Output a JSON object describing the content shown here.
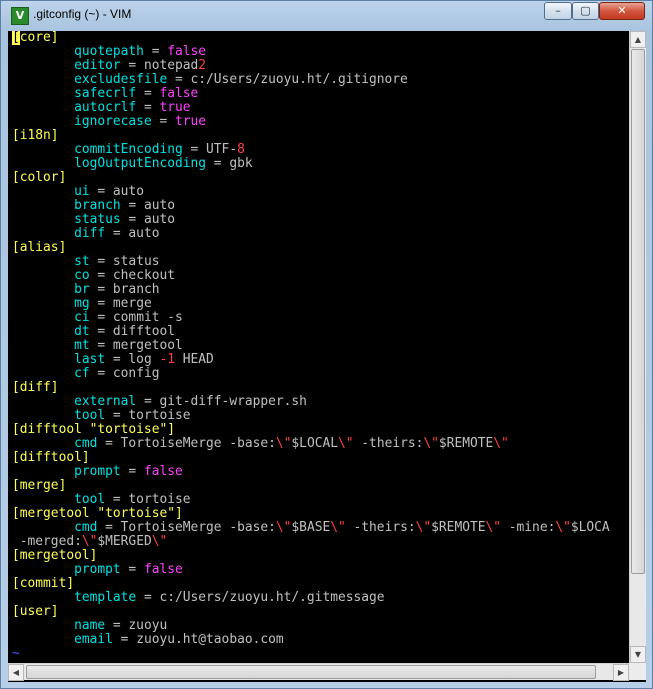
{
  "window": {
    "title": ".gitconfig (~) - VIM",
    "app_icon_label": "V",
    "controls": {
      "minimize": "–",
      "maximize": "▢",
      "close": "✕"
    }
  },
  "editor": {
    "colors": {
      "background": "#000000",
      "section_header": "#ffff55",
      "key": "#00e0e0",
      "boolean": "#ff40ff",
      "number_and_escape": "#ff4040",
      "plain": "#c0c0c0",
      "tilde": "#4060ff"
    },
    "lines": [
      [
        {
          "t": "[",
          "c": "cursor"
        },
        {
          "t": "core]",
          "c": "hdr"
        }
      ],
      [
        {
          "t": "        "
        },
        {
          "t": "quotepath",
          "c": "key"
        },
        {
          "t": " = "
        },
        {
          "t": "false",
          "c": "val"
        }
      ],
      [
        {
          "t": "        "
        },
        {
          "t": "editor",
          "c": "key"
        },
        {
          "t": " = notepad"
        },
        {
          "t": "2",
          "c": "num"
        }
      ],
      [
        {
          "t": "        "
        },
        {
          "t": "excludesfile",
          "c": "key"
        },
        {
          "t": " = c:/Users/zuoyu.ht/.gitignore"
        }
      ],
      [
        {
          "t": "        "
        },
        {
          "t": "safecrlf",
          "c": "key"
        },
        {
          "t": " = "
        },
        {
          "t": "false",
          "c": "val"
        }
      ],
      [
        {
          "t": "        "
        },
        {
          "t": "autocrlf",
          "c": "key"
        },
        {
          "t": " = "
        },
        {
          "t": "true",
          "c": "val"
        }
      ],
      [
        {
          "t": "        "
        },
        {
          "t": "ignorecase",
          "c": "key"
        },
        {
          "t": " = "
        },
        {
          "t": "true",
          "c": "val"
        }
      ],
      [
        {
          "t": "[i18n]",
          "c": "hdr"
        }
      ],
      [
        {
          "t": "        "
        },
        {
          "t": "commitEncoding",
          "c": "key"
        },
        {
          "t": " = UTF-"
        },
        {
          "t": "8",
          "c": "num"
        }
      ],
      [
        {
          "t": "        "
        },
        {
          "t": "logOutputEncoding",
          "c": "key"
        },
        {
          "t": " = gbk"
        }
      ],
      [
        {
          "t": "[color]",
          "c": "hdr"
        }
      ],
      [
        {
          "t": "        "
        },
        {
          "t": "ui",
          "c": "key"
        },
        {
          "t": " = auto"
        }
      ],
      [
        {
          "t": "        "
        },
        {
          "t": "branch",
          "c": "key"
        },
        {
          "t": " = auto"
        }
      ],
      [
        {
          "t": "        "
        },
        {
          "t": "status",
          "c": "key"
        },
        {
          "t": " = auto"
        }
      ],
      [
        {
          "t": "        "
        },
        {
          "t": "diff",
          "c": "key"
        },
        {
          "t": " = auto"
        }
      ],
      [
        {
          "t": "[alias]",
          "c": "hdr"
        }
      ],
      [
        {
          "t": "        "
        },
        {
          "t": "st",
          "c": "key"
        },
        {
          "t": " = status"
        }
      ],
      [
        {
          "t": "        "
        },
        {
          "t": "co",
          "c": "key"
        },
        {
          "t": " = checkout"
        }
      ],
      [
        {
          "t": "        "
        },
        {
          "t": "br",
          "c": "key"
        },
        {
          "t": " = branch"
        }
      ],
      [
        {
          "t": "        "
        },
        {
          "t": "mg",
          "c": "key"
        },
        {
          "t": " = merge"
        }
      ],
      [
        {
          "t": "        "
        },
        {
          "t": "ci",
          "c": "key"
        },
        {
          "t": " = commit -s"
        }
      ],
      [
        {
          "t": "        "
        },
        {
          "t": "dt",
          "c": "key"
        },
        {
          "t": " = difftool"
        }
      ],
      [
        {
          "t": "        "
        },
        {
          "t": "mt",
          "c": "key"
        },
        {
          "t": " = mergetool"
        }
      ],
      [
        {
          "t": "        "
        },
        {
          "t": "last",
          "c": "key"
        },
        {
          "t": " = log "
        },
        {
          "t": "-1",
          "c": "num"
        },
        {
          "t": " HEAD"
        }
      ],
      [
        {
          "t": "        "
        },
        {
          "t": "cf",
          "c": "key"
        },
        {
          "t": " = config"
        }
      ],
      [
        {
          "t": "[diff]",
          "c": "hdr"
        }
      ],
      [
        {
          "t": "        "
        },
        {
          "t": "external",
          "c": "key"
        },
        {
          "t": " = git-diff-wrapper.sh"
        }
      ],
      [
        {
          "t": "        "
        },
        {
          "t": "tool",
          "c": "key"
        },
        {
          "t": " = tortoise"
        }
      ],
      [
        {
          "t": "[difftool \"tortoise\"]",
          "c": "hdr"
        }
      ],
      [
        {
          "t": "        "
        },
        {
          "t": "cmd",
          "c": "key"
        },
        {
          "t": " = TortoiseMerge -base:"
        },
        {
          "t": "\\\"",
          "c": "esc"
        },
        {
          "t": "$LOCAL"
        },
        {
          "t": "\\\"",
          "c": "esc"
        },
        {
          "t": " -theirs:"
        },
        {
          "t": "\\\"",
          "c": "esc"
        },
        {
          "t": "$REMOTE"
        },
        {
          "t": "\\\"",
          "c": "esc"
        }
      ],
      [
        {
          "t": "[difftool]",
          "c": "hdr"
        }
      ],
      [
        {
          "t": "        "
        },
        {
          "t": "prompt",
          "c": "key"
        },
        {
          "t": " = "
        },
        {
          "t": "false",
          "c": "val"
        }
      ],
      [
        {
          "t": "[merge]",
          "c": "hdr"
        }
      ],
      [
        {
          "t": "        "
        },
        {
          "t": "tool",
          "c": "key"
        },
        {
          "t": " = tortoise"
        }
      ],
      [
        {
          "t": "[mergetool \"tortoise\"]",
          "c": "hdr"
        }
      ],
      [
        {
          "t": "        "
        },
        {
          "t": "cmd",
          "c": "key"
        },
        {
          "t": " = TortoiseMerge -base:"
        },
        {
          "t": "\\\"",
          "c": "esc"
        },
        {
          "t": "$BASE"
        },
        {
          "t": "\\\"",
          "c": "esc"
        },
        {
          "t": " -theirs:"
        },
        {
          "t": "\\\"",
          "c": "esc"
        },
        {
          "t": "$REMOTE"
        },
        {
          "t": "\\\"",
          "c": "esc"
        },
        {
          "t": " -mine:"
        },
        {
          "t": "\\\"",
          "c": "esc"
        },
        {
          "t": "$LOCA"
        }
      ],
      [
        {
          "t": " -merged:"
        },
        {
          "t": "\\\"",
          "c": "esc"
        },
        {
          "t": "$MERGED"
        },
        {
          "t": "\\\"",
          "c": "esc"
        }
      ],
      [
        {
          "t": "[mergetool]",
          "c": "hdr"
        }
      ],
      [
        {
          "t": "        "
        },
        {
          "t": "prompt",
          "c": "key"
        },
        {
          "t": " = "
        },
        {
          "t": "false",
          "c": "val"
        }
      ],
      [
        {
          "t": "[commit]",
          "c": "hdr"
        }
      ],
      [
        {
          "t": "        "
        },
        {
          "t": "template",
          "c": "key"
        },
        {
          "t": " = c:/Users/zuoyu.ht/.gitmessage"
        }
      ],
      [
        {
          "t": "[user]",
          "c": "hdr"
        }
      ],
      [
        {
          "t": "        "
        },
        {
          "t": "name",
          "c": "key"
        },
        {
          "t": " = zuoyu"
        }
      ],
      [
        {
          "t": "        "
        },
        {
          "t": "email",
          "c": "key"
        },
        {
          "t": " = zuoyu.ht@taobao.com"
        }
      ],
      [
        {
          "t": "~",
          "c": "tilde"
        }
      ]
    ]
  },
  "scrollbars": {
    "up": "▲",
    "down": "▼",
    "left": "◀",
    "right": "▶"
  }
}
